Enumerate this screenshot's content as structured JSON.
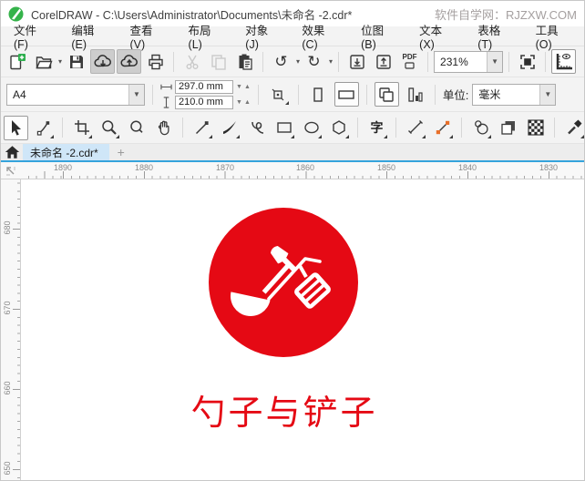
{
  "colors": {
    "logo_red": "#e50914",
    "tab_accent": "#35a3dc"
  },
  "titlebar": {
    "title": "CorelDRAW - C:\\Users\\Administrator\\Documents\\未命名 -2.cdr*",
    "brand": "软件自学网：RJZXW.COM"
  },
  "menu": {
    "items": [
      "文件(F)",
      "编辑(E)",
      "查看(V)",
      "布局(L)",
      "对象(J)",
      "效果(C)",
      "位图(B)",
      "文本(X)",
      "表格(T)",
      "工具(O)"
    ]
  },
  "toolbar": {
    "zoom_level": "231%",
    "pdf_label": "PDF"
  },
  "property_bar": {
    "page_size": "A4",
    "page_width": "297.0 mm",
    "page_height": "210.0 mm",
    "units_label": "单位:",
    "units_value": "毫米"
  },
  "toolbox": {
    "text_tool_glyph": "字"
  },
  "tabbar": {
    "active_tab": "未命名 -2.cdr*",
    "new_tab_label": "+"
  },
  "rulers": {
    "h": [
      "1890",
      "1880",
      "1870",
      "1860",
      "1850",
      "1840",
      "1830"
    ],
    "v": [
      "680",
      "670",
      "660",
      "650"
    ]
  },
  "canvas": {
    "logo_text": "勺子与铲子"
  }
}
